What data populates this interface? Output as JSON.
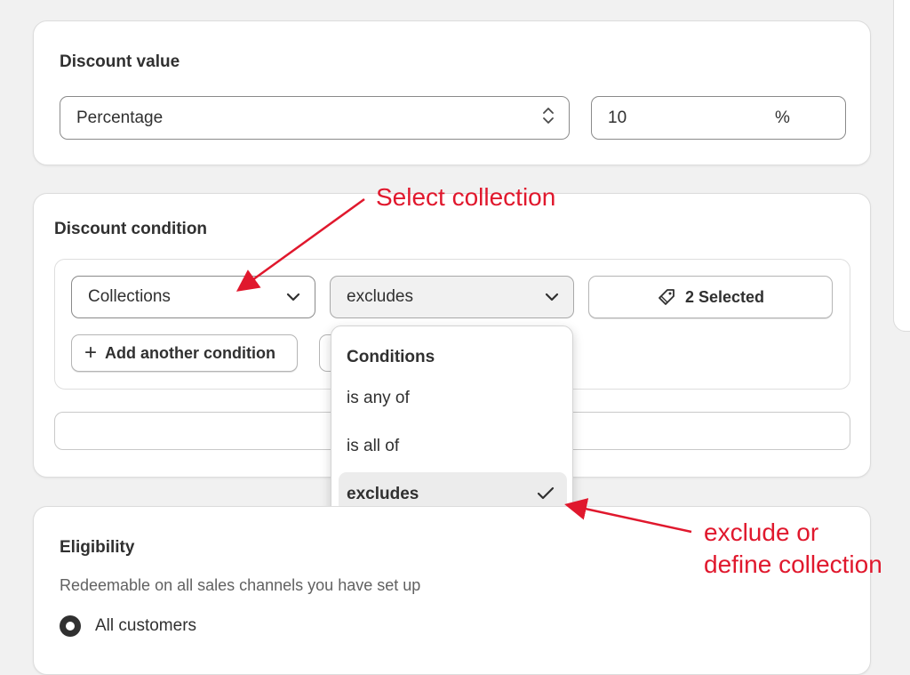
{
  "discount_value": {
    "title": "Discount value",
    "type_select": "Percentage",
    "amount_value": "10",
    "amount_suffix": "%"
  },
  "discount_condition": {
    "title": "Discount condition",
    "target_select": "Collections",
    "operator_select": "excludes",
    "selection_button": "2 Selected",
    "add_condition_button": "Add another condition"
  },
  "conditions_dropdown": {
    "header": "Conditions",
    "options": [
      "is any of",
      "is all of",
      "excludes"
    ],
    "selected": "excludes"
  },
  "eligibility": {
    "title": "Eligibility",
    "description": "Redeemable on all sales channels you have set up",
    "radio_label": "All customers"
  },
  "annotations": {
    "select_collection": "Select collection",
    "exclude_line1": "exclude or",
    "exclude_line2": "define collection",
    "color": "#e0182d"
  }
}
